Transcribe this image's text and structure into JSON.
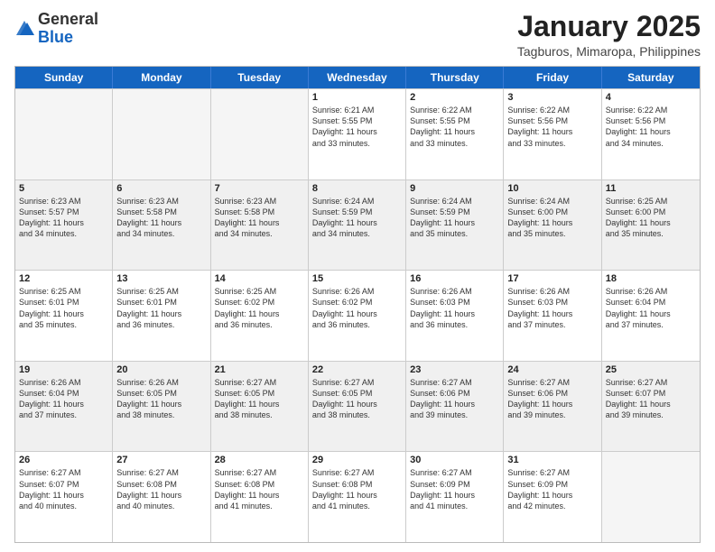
{
  "header": {
    "logo_general": "General",
    "logo_blue": "Blue",
    "title": "January 2025",
    "subtitle": "Tagburos, Mimaropa, Philippines"
  },
  "weekdays": [
    "Sunday",
    "Monday",
    "Tuesday",
    "Wednesday",
    "Thursday",
    "Friday",
    "Saturday"
  ],
  "rows": [
    [
      {
        "day": "",
        "info": "",
        "empty": true
      },
      {
        "day": "",
        "info": "",
        "empty": true
      },
      {
        "day": "",
        "info": "",
        "empty": true
      },
      {
        "day": "1",
        "info": "Sunrise: 6:21 AM\nSunset: 5:55 PM\nDaylight: 11 hours\nand 33 minutes."
      },
      {
        "day": "2",
        "info": "Sunrise: 6:22 AM\nSunset: 5:55 PM\nDaylight: 11 hours\nand 33 minutes."
      },
      {
        "day": "3",
        "info": "Sunrise: 6:22 AM\nSunset: 5:56 PM\nDaylight: 11 hours\nand 33 minutes."
      },
      {
        "day": "4",
        "info": "Sunrise: 6:22 AM\nSunset: 5:56 PM\nDaylight: 11 hours\nand 34 minutes."
      }
    ],
    [
      {
        "day": "5",
        "info": "Sunrise: 6:23 AM\nSunset: 5:57 PM\nDaylight: 11 hours\nand 34 minutes.",
        "shaded": true
      },
      {
        "day": "6",
        "info": "Sunrise: 6:23 AM\nSunset: 5:58 PM\nDaylight: 11 hours\nand 34 minutes.",
        "shaded": true
      },
      {
        "day": "7",
        "info": "Sunrise: 6:23 AM\nSunset: 5:58 PM\nDaylight: 11 hours\nand 34 minutes.",
        "shaded": true
      },
      {
        "day": "8",
        "info": "Sunrise: 6:24 AM\nSunset: 5:59 PM\nDaylight: 11 hours\nand 34 minutes.",
        "shaded": true
      },
      {
        "day": "9",
        "info": "Sunrise: 6:24 AM\nSunset: 5:59 PM\nDaylight: 11 hours\nand 35 minutes.",
        "shaded": true
      },
      {
        "day": "10",
        "info": "Sunrise: 6:24 AM\nSunset: 6:00 PM\nDaylight: 11 hours\nand 35 minutes.",
        "shaded": true
      },
      {
        "day": "11",
        "info": "Sunrise: 6:25 AM\nSunset: 6:00 PM\nDaylight: 11 hours\nand 35 minutes.",
        "shaded": true
      }
    ],
    [
      {
        "day": "12",
        "info": "Sunrise: 6:25 AM\nSunset: 6:01 PM\nDaylight: 11 hours\nand 35 minutes."
      },
      {
        "day": "13",
        "info": "Sunrise: 6:25 AM\nSunset: 6:01 PM\nDaylight: 11 hours\nand 36 minutes."
      },
      {
        "day": "14",
        "info": "Sunrise: 6:25 AM\nSunset: 6:02 PM\nDaylight: 11 hours\nand 36 minutes."
      },
      {
        "day": "15",
        "info": "Sunrise: 6:26 AM\nSunset: 6:02 PM\nDaylight: 11 hours\nand 36 minutes."
      },
      {
        "day": "16",
        "info": "Sunrise: 6:26 AM\nSunset: 6:03 PM\nDaylight: 11 hours\nand 36 minutes."
      },
      {
        "day": "17",
        "info": "Sunrise: 6:26 AM\nSunset: 6:03 PM\nDaylight: 11 hours\nand 37 minutes."
      },
      {
        "day": "18",
        "info": "Sunrise: 6:26 AM\nSunset: 6:04 PM\nDaylight: 11 hours\nand 37 minutes."
      }
    ],
    [
      {
        "day": "19",
        "info": "Sunrise: 6:26 AM\nSunset: 6:04 PM\nDaylight: 11 hours\nand 37 minutes.",
        "shaded": true
      },
      {
        "day": "20",
        "info": "Sunrise: 6:26 AM\nSunset: 6:05 PM\nDaylight: 11 hours\nand 38 minutes.",
        "shaded": true
      },
      {
        "day": "21",
        "info": "Sunrise: 6:27 AM\nSunset: 6:05 PM\nDaylight: 11 hours\nand 38 minutes.",
        "shaded": true
      },
      {
        "day": "22",
        "info": "Sunrise: 6:27 AM\nSunset: 6:05 PM\nDaylight: 11 hours\nand 38 minutes.",
        "shaded": true
      },
      {
        "day": "23",
        "info": "Sunrise: 6:27 AM\nSunset: 6:06 PM\nDaylight: 11 hours\nand 39 minutes.",
        "shaded": true
      },
      {
        "day": "24",
        "info": "Sunrise: 6:27 AM\nSunset: 6:06 PM\nDaylight: 11 hours\nand 39 minutes.",
        "shaded": true
      },
      {
        "day": "25",
        "info": "Sunrise: 6:27 AM\nSunset: 6:07 PM\nDaylight: 11 hours\nand 39 minutes.",
        "shaded": true
      }
    ],
    [
      {
        "day": "26",
        "info": "Sunrise: 6:27 AM\nSunset: 6:07 PM\nDaylight: 11 hours\nand 40 minutes."
      },
      {
        "day": "27",
        "info": "Sunrise: 6:27 AM\nSunset: 6:08 PM\nDaylight: 11 hours\nand 40 minutes."
      },
      {
        "day": "28",
        "info": "Sunrise: 6:27 AM\nSunset: 6:08 PM\nDaylight: 11 hours\nand 41 minutes."
      },
      {
        "day": "29",
        "info": "Sunrise: 6:27 AM\nSunset: 6:08 PM\nDaylight: 11 hours\nand 41 minutes."
      },
      {
        "day": "30",
        "info": "Sunrise: 6:27 AM\nSunset: 6:09 PM\nDaylight: 11 hours\nand 41 minutes."
      },
      {
        "day": "31",
        "info": "Sunrise: 6:27 AM\nSunset: 6:09 PM\nDaylight: 11 hours\nand 42 minutes."
      },
      {
        "day": "",
        "info": "",
        "empty": true
      }
    ]
  ]
}
